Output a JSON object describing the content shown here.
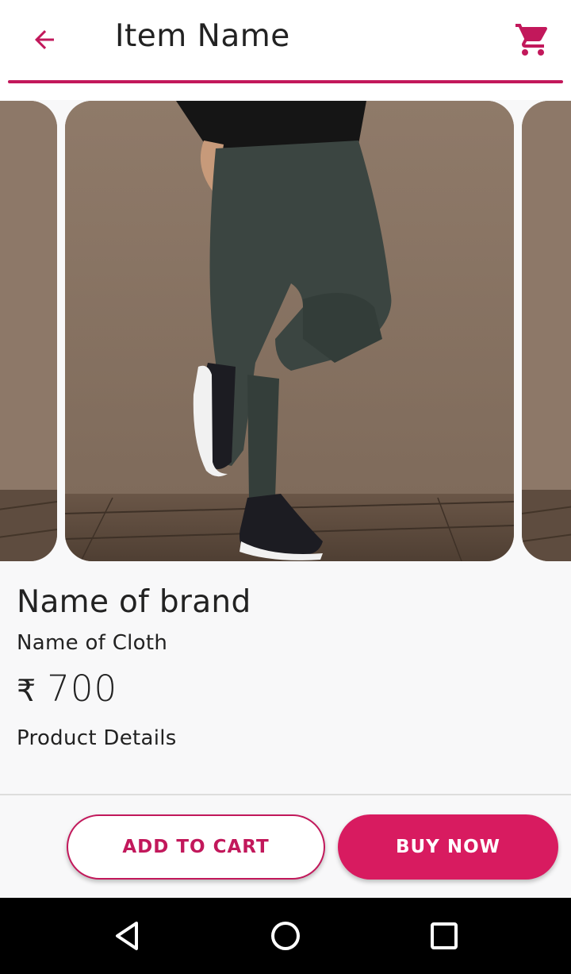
{
  "header": {
    "title": "Item Name",
    "back_icon": "arrow-back-icon",
    "cart_icon": "shopping-cart-icon"
  },
  "product": {
    "brand": "Name of brand",
    "cloth": "Name of Cloth",
    "currency_symbol": "₹",
    "price": "700",
    "details_label": "Product Details"
  },
  "actions": {
    "add_to_cart": "ADD TO CART",
    "buy_now": "BUY NOW"
  },
  "navigation_bar": {
    "back_icon": "nav-back-triangle-icon",
    "home_icon": "nav-home-circle-icon",
    "recents_icon": "nav-recents-square-icon"
  },
  "colors": {
    "accent": "#c2185b",
    "accent_fill": "#d81b60",
    "background": "#f8f8f9",
    "navbar": "#000000"
  }
}
